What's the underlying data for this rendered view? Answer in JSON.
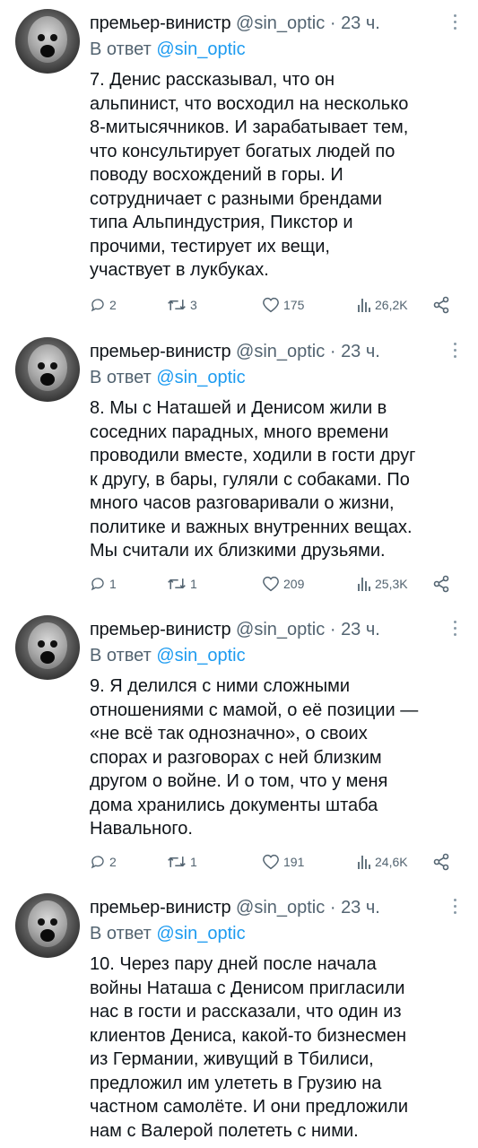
{
  "tweets": [
    {
      "author": "премьер-винистр",
      "handle": "@sin_optic",
      "dot": "·",
      "time": "23 ч.",
      "reply_prefix": "В ответ",
      "reply_to": "@sin_optic",
      "lines": [
        "7. Денис рассказывал, что он",
        "альпинист, что восходил на несколько",
        "8-митысячников. И зарабатывает тем,",
        "что консультирует богатых людей по",
        "поводу восхождений в горы. И",
        "сотрудничает с разными брендами",
        "типа Альпиндустрия, Пикстор и",
        "прочими, тестирует их вещи,",
        "участвует в лукбуках."
      ],
      "replies": "2",
      "retweets": "3",
      "likes": "175",
      "views": "26,2K"
    },
    {
      "author": "премьер-винистр",
      "handle": "@sin_optic",
      "dot": "·",
      "time": "23 ч.",
      "reply_prefix": "В ответ",
      "reply_to": "@sin_optic",
      "lines": [
        "8. Мы с Наташей и Денисом жили в",
        "соседних парадных, много времени",
        "проводили вместе, ходили в гости друг",
        "к другу, в бары, гуляли с собаками. По",
        "много часов разговаривали о жизни,",
        "политике и важных внутренних вещах.",
        "Мы считали их близкими друзьями."
      ],
      "replies": "1",
      "retweets": "1",
      "likes": "209",
      "views": "25,3K"
    },
    {
      "author": "премьер-винистр",
      "handle": "@sin_optic",
      "dot": "·",
      "time": "23 ч.",
      "reply_prefix": "В ответ",
      "reply_to": "@sin_optic",
      "lines": [
        "9. Я делился с ними сложными",
        "отношениями с мамой, о её позиции —",
        "«не всё так однозначно», о своих",
        "спорах и разговорах с ней близким",
        "другом о войне. И о том, что у меня",
        "дома хранились документы штаба",
        "Навального."
      ],
      "replies": "2",
      "retweets": "1",
      "likes": "191",
      "views": "24,6K"
    },
    {
      "author": "премьер-винистр",
      "handle": "@sin_optic",
      "dot": "·",
      "time": "23 ч.",
      "reply_prefix": "В ответ",
      "reply_to": "@sin_optic",
      "lines": [
        "10. Через пару дней после начала",
        "войны Наташа с Денисом пригласили",
        "нас в гости и рассказали, что один из",
        "клиентов Дениса, какой-то бизнесмен",
        "из Германии, живущий в Тбилиси,",
        "предложил им улететь в Грузию на",
        "частном самолёте. И они предложили",
        "нам с Валерой полететь с ними."
      ]
    }
  ],
  "colors": {
    "link": "#1d9bf0",
    "muted": "#536471",
    "text": "#0f1419"
  },
  "icons": [
    "reply-icon",
    "retweet-icon",
    "like-icon",
    "views-icon",
    "share-icon",
    "more-icon"
  ]
}
